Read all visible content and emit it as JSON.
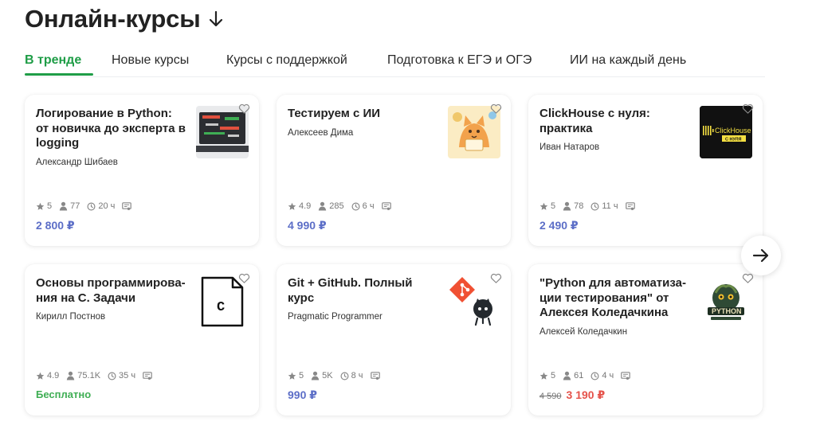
{
  "page": {
    "title": "Онлайн-курсы"
  },
  "tabs": [
    {
      "label": "В тренде",
      "active": true
    },
    {
      "label": "Новые курсы"
    },
    {
      "label": "Курсы с поддержкой"
    },
    {
      "label": "Подготовка к ЕГЭ и ОГЭ"
    },
    {
      "label": "ИИ на каждый день"
    }
  ],
  "cards": [
    {
      "title": "Логирование в Python: от новичка до эксперта в logging",
      "author": "Александр Шибаев",
      "rating": "5",
      "students": "77",
      "duration": "20 ч",
      "price": "2 800 ₽",
      "thumb": "laptop-logging-thumb"
    },
    {
      "title": "Тестируем с ИИ",
      "author": "Алексеев Дима",
      "rating": "4.9",
      "students": "285",
      "duration": "6 ч",
      "price": "4 990 ₽",
      "thumb": "cat-illustration-thumb"
    },
    {
      "title": "ClickHouse с нуля: практика",
      "author": "Иван Натаров",
      "rating": "5",
      "students": "78",
      "duration": "11 ч",
      "price": "2 490 ₽",
      "thumb": "clickhouse-logo-thumb",
      "thumb_text": [
        "ClickHouse",
        "С НУЛЯ"
      ]
    },
    {
      "title": "Основы программирова-ния на C. Задачи",
      "author": "Кирилл Постнов",
      "rating": "4.9",
      "students": "75.1K",
      "duration": "35 ч",
      "price": "Бесплатно",
      "price_type": "free",
      "thumb": "c-file-icon-thumb",
      "thumb_text": [
        "C"
      ]
    },
    {
      "title": "Git + GitHub. Полный курс",
      "author": "Pragmatic Programmer",
      "rating": "5",
      "students": "5K",
      "duration": "8 ч",
      "price": "990 ₽",
      "thumb": "git-github-logo-thumb"
    },
    {
      "title": "\"Python для автоматиза-ции тестирования\" от Алексея Коледачкина",
      "author": "Алексей Коледачкин",
      "rating": "5",
      "students": "61",
      "duration": "4 ч",
      "old_price": "4 590",
      "price": "3 190 ₽",
      "price_type": "discount",
      "thumb": "python-testing-logo-thumb",
      "thumb_text": [
        "PYTHON"
      ]
    }
  ],
  "colors": {
    "accent": "#1f9d47",
    "price": "#5c6ec7",
    "free": "#3fae54",
    "discount": "#e5534b"
  },
  "icons": {
    "heading": "arrow-down-icon",
    "next": "arrow-right-icon",
    "favorite": "heart-icon"
  }
}
